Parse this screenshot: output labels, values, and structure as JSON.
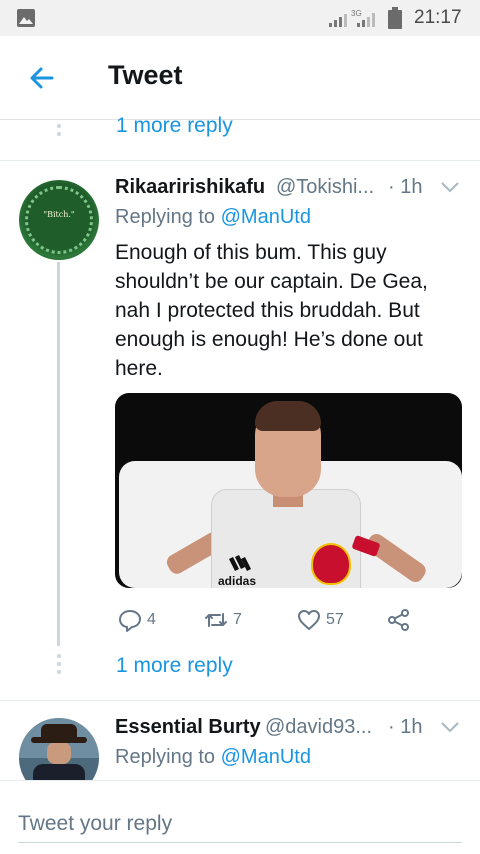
{
  "status_bar": {
    "time": "21:17",
    "network": "3G"
  },
  "header": {
    "title": "Tweet",
    "back_icon": "back-arrow-icon"
  },
  "thread_top": {
    "more_reply_label": "1 more reply"
  },
  "tweet": {
    "avatar_text": "\"Bitch.\"",
    "display_name": "Rikaaririshikafu",
    "handle": "@Tokishi...",
    "time": "· 1h",
    "replying_prefix": "Replying to ",
    "replying_to": "@ManUtd",
    "text": "Enough of this bum. This guy shouldn’t be our captain. De Gea, nah I protected this bruddah. But enough is enough! He’s done out here.",
    "media_brand_text": "adidas",
    "actions": {
      "reply_count": "4",
      "retweet_count": "7",
      "like_count": "57"
    }
  },
  "thread_mid": {
    "more_reply_label": "1 more reply"
  },
  "tweet2": {
    "display_name": "Essential Burty",
    "handle": "@david93...",
    "time": "· 1h",
    "replying_prefix": "Replying to ",
    "replying_to": "@ManUtd"
  },
  "reply_bar": {
    "placeholder": "Tweet your reply"
  },
  "colors": {
    "accent": "#1b95e0",
    "text_secondary": "#657786",
    "divider": "#e6ecf0"
  }
}
